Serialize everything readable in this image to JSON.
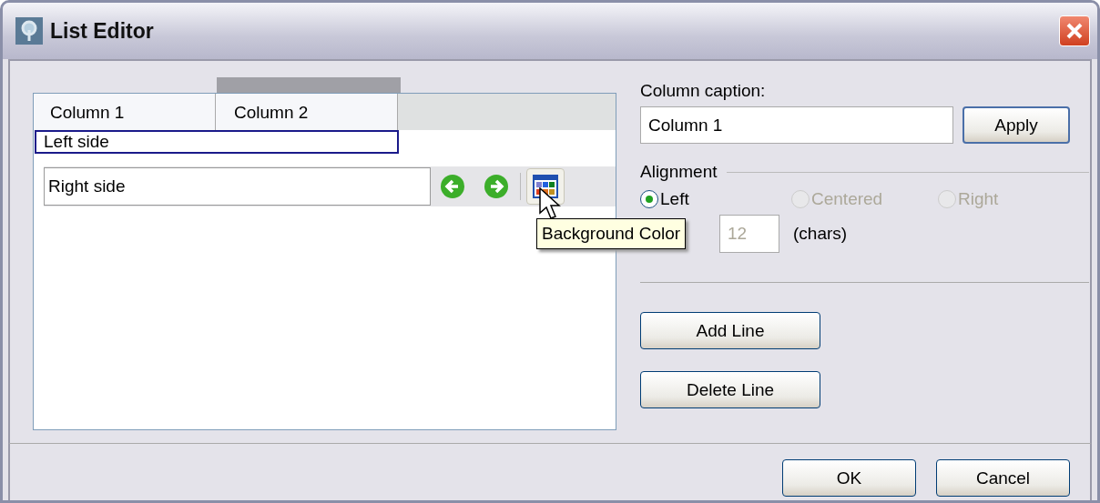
{
  "window": {
    "title": "List Editor"
  },
  "editor": {
    "columns": [
      {
        "label": "Column 1"
      },
      {
        "label": "Column 2"
      }
    ],
    "left_field": {
      "value": "Left side",
      "focused": true
    },
    "right_field": {
      "value": "Right side"
    },
    "tooltip": "Background Color"
  },
  "caption": {
    "label": "Column caption:",
    "value": "Column 1",
    "button": "Apply"
  },
  "alignment": {
    "label": "Alignment",
    "options": [
      {
        "label": "Left",
        "selected": true,
        "disabled": false
      },
      {
        "label": "Centered",
        "selected": false,
        "disabled": true
      },
      {
        "label": "Right",
        "selected": false,
        "disabled": true
      }
    ]
  },
  "width": {
    "value": "12",
    "unit": "(chars)",
    "disabled": true
  },
  "line_buttons": [
    "Add Line",
    "Delete Line"
  ],
  "buttons": [
    "OK",
    "Cancel"
  ]
}
